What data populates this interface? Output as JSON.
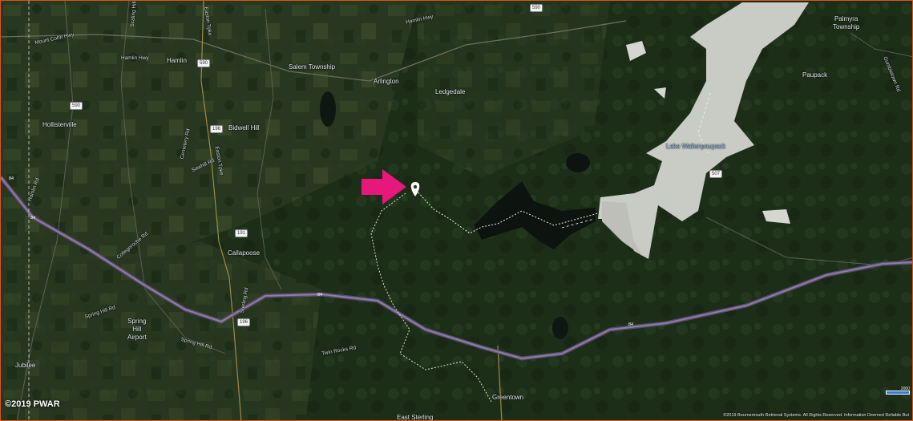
{
  "map": {
    "copyright": "©2019 PWAR",
    "attribution": "©2019 Bournemouth Retrieval Systems. All Rights Reserved. Information Deemed Reliable But",
    "scale_label": "2000",
    "marker": "location-pin",
    "arrow_color": "#e8177c",
    "road_shields": {
      "s590_top": "590",
      "s590_left": "590",
      "s590_mid": "590",
      "s196_a": "196",
      "s191": "191",
      "s196_b": "196",
      "s507": "507",
      "i84_a": "84",
      "i84_b": "84",
      "i84_c": "84"
    },
    "labels": {
      "palmyra": "Palmyra\nTownship",
      "paupack": "Paupack",
      "hamlin_hwy_right": "Hamlin Hwy",
      "mount_cobb": "Mount Cobb Hwy",
      "hamlin_hwy_left": "Hamlin Hwy",
      "hamlin": "Hamlin",
      "salem": "Salem Township",
      "arlington": "Arlington",
      "ledgedale": "Ledgedale",
      "hollisterville": "Hollisterville",
      "bidwell": "Bidwell Hill",
      "easton_a": "Easton Tpke",
      "easton_b": "Easton Tpke",
      "sawhill": "Sawhill Rd",
      "lake_wallenpaupack": "Lake Wallenpaupack",
      "callapoose": "Callapoose",
      "spring_hill_airport": "Spring\nHill\nAirport",
      "jubilee": "Jubilee",
      "greentown": "Greentown",
      "east_sterling": "East Sterling",
      "spring_hill_rd_a": "Spring Hill Rd",
      "spring_hill_rd_b": "Spring Hill Rd",
      "twin_rocks": "Twin Rocks Rd",
      "cemetery": "Cemetery Rd",
      "hamlin_rd": "Hamlin Rd",
      "coleman": "Collegeroche Rd",
      "sterling_rd": "Sterling Rd",
      "gubbins": "Gumbletown Rd",
      "scaling": "Scaling Hill Rd"
    }
  }
}
